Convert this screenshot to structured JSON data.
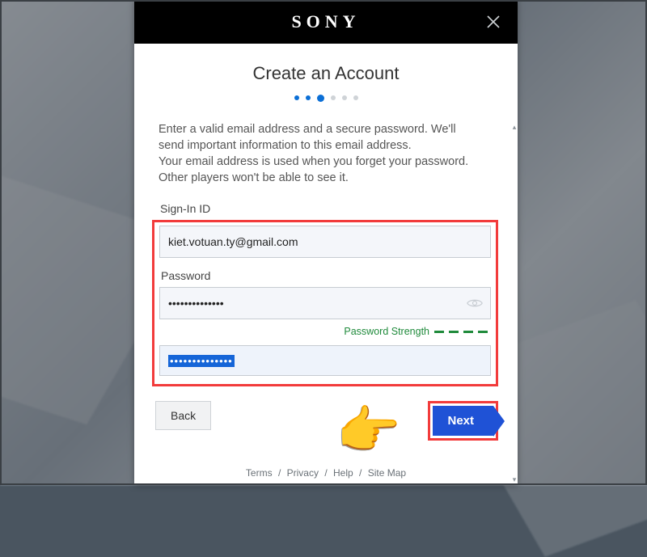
{
  "header": {
    "brand": "SONY",
    "title": "Create an Account"
  },
  "stepper": {
    "current": 3,
    "total": 6
  },
  "body": {
    "help_line1": "Enter a valid email address and a secure password. We'll",
    "help_line2": "send important information to this email address.",
    "help_line3": "Your email address is used when you forget your password.",
    "help_line4": "Other players won't be able to see it."
  },
  "fields": {
    "signin_label": "Sign-In ID",
    "signin_value": "kiet.votuan.ty@gmail.com",
    "password_label": "Password",
    "password_value": "••••••••••••••",
    "confirm_value": "••••••••••••••",
    "strength_label": "Password Strength"
  },
  "buttons": {
    "back": "Back",
    "next": "Next"
  },
  "footer": {
    "terms": "Terms",
    "privacy": "Privacy",
    "help": "Help",
    "sitemap": "Site Map"
  }
}
